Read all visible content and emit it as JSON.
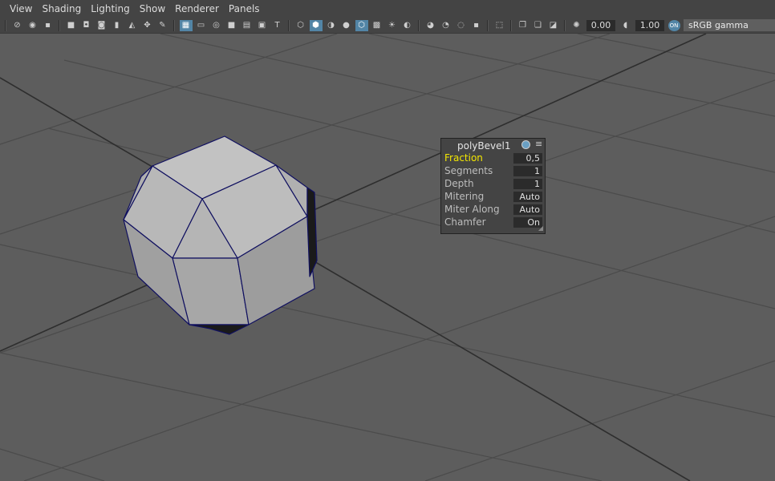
{
  "menu": [
    "View",
    "Shading",
    "Lighting",
    "Show",
    "Renderer",
    "Panels"
  ],
  "toolbar": {
    "exposure_value": "0.00",
    "gamma_value": "1.00",
    "color_mgmt_badge": "ON",
    "color_space": "sRGB gamma"
  },
  "hud": {
    "title": "polyBevel1",
    "rows": [
      {
        "label": "Fraction",
        "value": "0,5"
      },
      {
        "label": "Segments",
        "value": "1"
      },
      {
        "label": "Depth",
        "value": "1"
      },
      {
        "label": "Mitering",
        "value": "Auto"
      },
      {
        "label": "Miter Along",
        "value": "Auto"
      },
      {
        "label": "Chamfer",
        "value": "On"
      }
    ]
  },
  "colors": {
    "viewport_bg": "#5d5d5d",
    "grid": "#4b4b4b",
    "axis": "#2e2e2e",
    "mesh_face": "#a9a9a9",
    "mesh_face_light": "#c5c5c5",
    "mesh_edge": "#101060",
    "highlight": "#f2e600"
  }
}
